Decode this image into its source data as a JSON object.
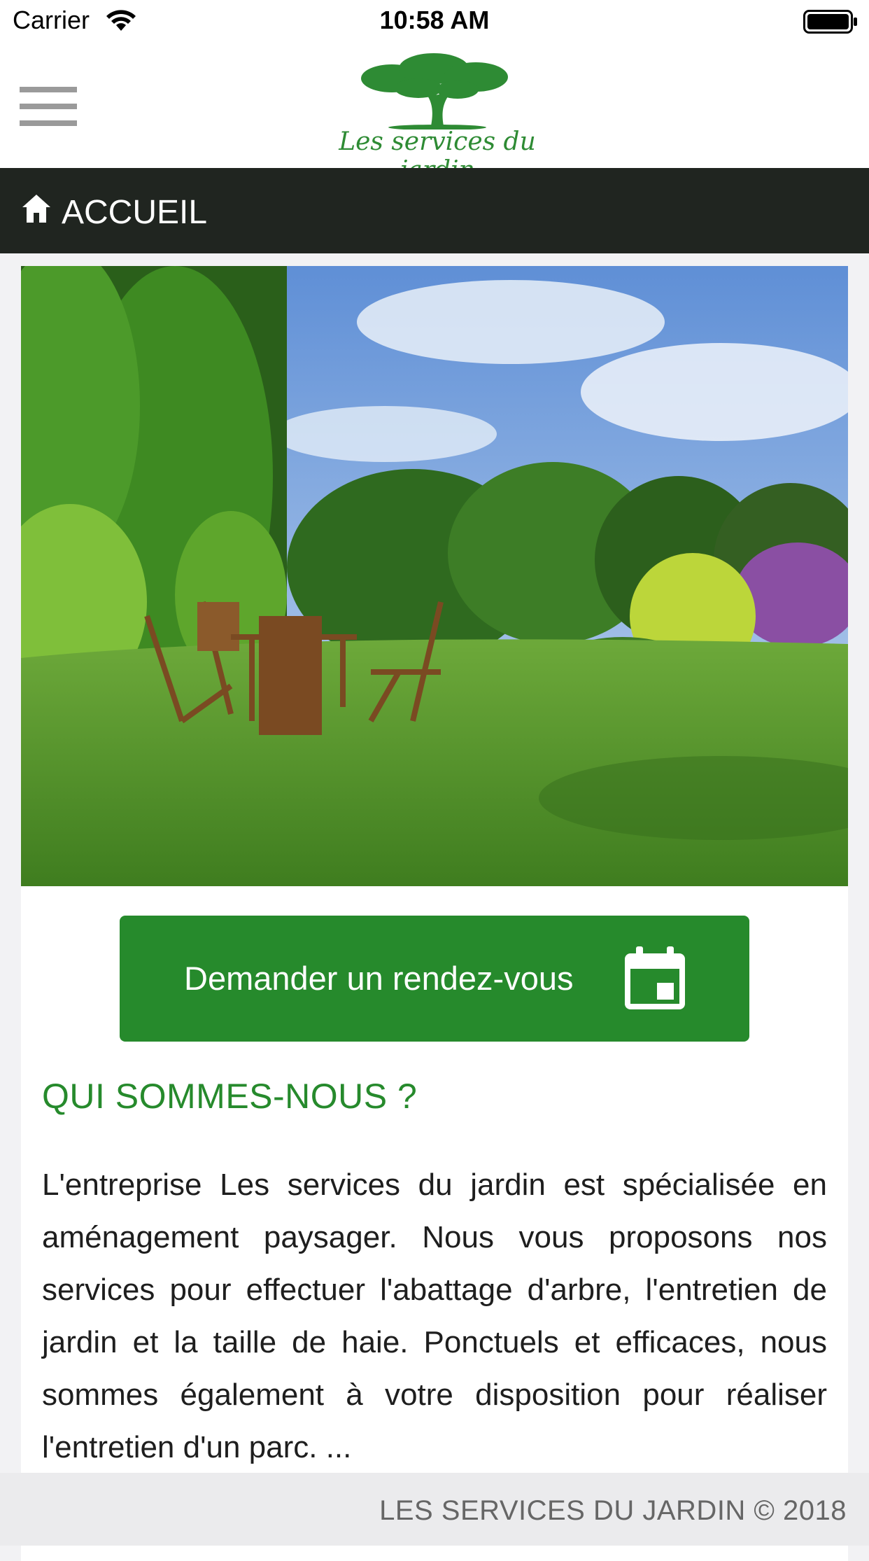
{
  "status_bar": {
    "carrier": "Carrier",
    "time": "10:58 AM",
    "icons": [
      "wifi-icon",
      "battery-icon"
    ]
  },
  "header": {
    "menu_icon": "hamburger-menu-icon",
    "logo_text": "Les services du jardin"
  },
  "title_bar": {
    "icon": "home-icon",
    "title": "ACCUEIL"
  },
  "hero": {
    "image": "garden-photo"
  },
  "cta": {
    "label": "Demander un rendez-vous",
    "icon": "calendar-icon"
  },
  "about": {
    "heading": "QUI SOMMES-NOUS ?",
    "body": "L'entreprise Les services du jardin est spécialisée en aménagement paysager. Nous vous proposons nos services pour effectuer l'abattage d'arbre, l'entretien de jardin et la taille de haie. Ponctuels et efficaces, nous sommes également à votre disposition pour réaliser l'entretien d'un parc. ..."
  },
  "footer": {
    "text": "LES SERVICES DU JARDIN © 2018"
  },
  "colors": {
    "brand_green": "#268a2c",
    "title_bar_bg": "#202520",
    "footer_bg": "#ebebed"
  }
}
